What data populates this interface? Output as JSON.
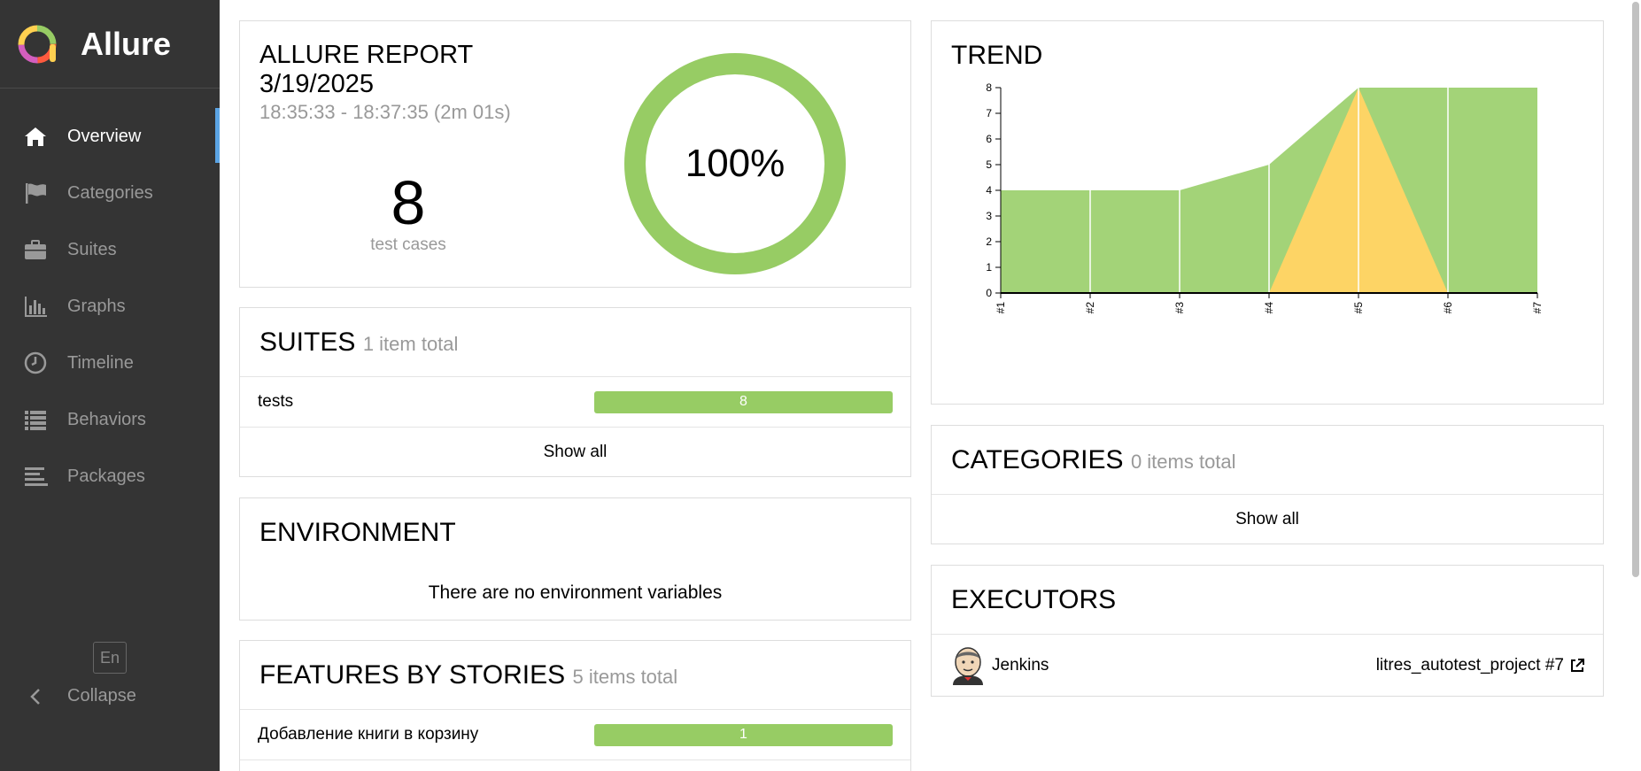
{
  "sidebar": {
    "brand": "Allure",
    "items": [
      {
        "label": "Overview",
        "icon": "home-icon",
        "active": true
      },
      {
        "label": "Categories",
        "icon": "flag-icon",
        "active": false
      },
      {
        "label": "Suites",
        "icon": "briefcase-icon",
        "active": false
      },
      {
        "label": "Graphs",
        "icon": "bar-chart-icon",
        "active": false
      },
      {
        "label": "Timeline",
        "icon": "clock-icon",
        "active": false
      },
      {
        "label": "Behaviors",
        "icon": "list-icon",
        "active": false
      },
      {
        "label": "Packages",
        "icon": "align-left-icon",
        "active": false
      }
    ],
    "language": "En",
    "collapse": "Collapse"
  },
  "summary": {
    "title_line1": "ALLURE REPORT",
    "title_line2": "3/19/2025",
    "time": "18:35:33 - 18:37:35 (2m 01s)",
    "test_count": "8",
    "test_label": "test cases",
    "percent": "100%",
    "pass_fraction": 1.0
  },
  "suites": {
    "title": "SUITES",
    "subtitle": "1 item total",
    "rows": [
      {
        "name": "tests",
        "value": "8"
      }
    ],
    "show_all": "Show all"
  },
  "environment": {
    "title": "ENVIRONMENT",
    "message": "There are no environment variables"
  },
  "features": {
    "title": "FEATURES BY STORIES",
    "subtitle": "5 items total",
    "rows": [
      {
        "name": "Добавление книги в корзину",
        "value": "1"
      }
    ]
  },
  "trend": {
    "title": "TREND"
  },
  "chart_data": {
    "type": "area",
    "categories": [
      "#1",
      "#2",
      "#3",
      "#4",
      "#5",
      "#6",
      "#7"
    ],
    "series": [
      {
        "status": "passed",
        "values": [
          4,
          4,
          4,
          5,
          8,
          8,
          8
        ]
      },
      {
        "status": "broken",
        "values": [
          0,
          0,
          0,
          0,
          8,
          0,
          0
        ]
      }
    ],
    "yticks": [
      0,
      1,
      2,
      3,
      4,
      5,
      6,
      7,
      8
    ],
    "ylim": [
      0,
      8
    ],
    "colors": {
      "passed": "#a3d378",
      "broken": "#fdd465"
    },
    "stacked": false
  },
  "categories": {
    "title": "CATEGORIES",
    "subtitle": "0 items total",
    "show_all": "Show all"
  },
  "executors": {
    "title": "EXECUTORS",
    "name": "Jenkins",
    "build": "litres_autotest_project #7"
  },
  "colors": {
    "sidebar_bg": "#343434",
    "accent": "#5ba4e4",
    "passed": "#97cc64"
  }
}
